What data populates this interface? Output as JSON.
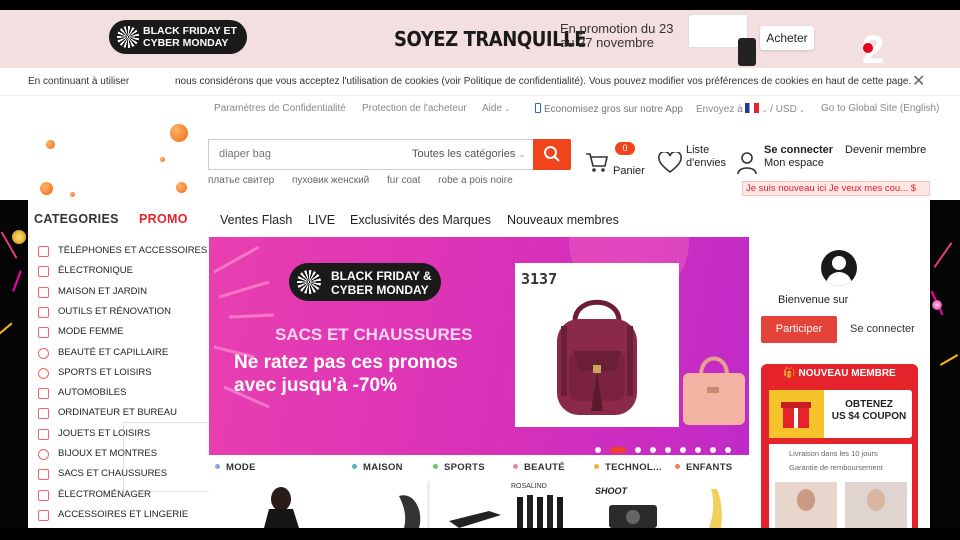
{
  "banner": {
    "bf_line1": "BLACK FRIDAY ET",
    "bf_line2": "CYBER MONDAY",
    "headline": "SOYEZ TRANQUILLE",
    "dates_line1": "En promotion du 23",
    "dates_line2": "au 27 novembre",
    "cta": "Acheter",
    "channel_logo": "2"
  },
  "cookie": {
    "text_start": "En continuant à utiliser",
    "text_rest": "nous considérons que vous acceptez l'utilisation de cookies (voir Politique de confidentialité). Vous pouvez modifier vos préférences de cookies en haut de cette page."
  },
  "utility": {
    "privacy": "Paramètres de Confidentialité",
    "buyer_protection": "Protection de l'acheteur",
    "help": "Aide",
    "app": "Economisez gros sur notre App",
    "ship_to": "Envoyez à",
    "currency": "USD",
    "global": "Go to Global Site (English)"
  },
  "search": {
    "placeholder": "diaper bag",
    "category": "Toutes les catégories",
    "suggestions": [
      "платье свитер",
      "пуховик женский",
      "fur coat",
      "robe a pois noire"
    ]
  },
  "header": {
    "cart_count": "0",
    "cart_label": "Panier",
    "wish_line1": "Liste",
    "wish_line2": "d'envies",
    "login": "Se connecter",
    "my_space": "Mon espace",
    "become_member": "Devenir membre",
    "newbie": "Je suis nouveau ici Je veux mes cou... $"
  },
  "nav": {
    "categories_tab": "CATEGORIES",
    "promo_tab": "PROMO",
    "links": [
      "Ventes Flash",
      "LIVE",
      "Exclusivités des Marques",
      "Nouveaux membres"
    ]
  },
  "sidebar": {
    "items": [
      "Téléphones et Accessoires",
      "Électronique",
      "Maison et Jardin",
      "Outils et Rénovation",
      "Mode Femme",
      "Beauté et Capillaire",
      "Sports et Loisirs",
      "Automobiles",
      "Ordinateur et Bureau",
      "Jouets et Loisirs",
      "Bijoux et Montres",
      "Sacs et Chaussures",
      "Électroménager",
      "Accessoires et Lingerie"
    ]
  },
  "hero": {
    "bf_line1": "BLACK FRIDAY &",
    "bf_line2": "CYBER MONDAY",
    "subtitle": "SACS ET CHAUSSURES",
    "title_line1": "Ne ratez pas ces promos",
    "title_line2": "avec jusqu'à -70%",
    "product_code": "3137",
    "slides": 10,
    "active_slide": 1
  },
  "category_row": [
    {
      "label": "MODE",
      "color": "#8aa6d6"
    },
    {
      "label": "MAISON",
      "color": "#5ab0c8"
    },
    {
      "label": "SPORTS",
      "color": "#6cc36c"
    },
    {
      "label": "BEAUTÉ",
      "color": "#f08a9a"
    },
    {
      "label": "TECHNOL...",
      "color": "#e9b63a"
    },
    {
      "label": "ENFANTS",
      "color": "#f08050"
    }
  ],
  "product_labels": {
    "brand1": "ROSALIND",
    "brand2": "SHOOT"
  },
  "right_panel": {
    "welcome": "Bienvenue sur",
    "participate": "Participer",
    "login": "Se connecter",
    "new_member_title": "NOUVEAU MEMBRE",
    "coupon_line1": "OBTENEZ",
    "coupon_line2": "US $4 COUPON",
    "delivery": "Livraison dans les 10 jours",
    "refund": "Garantie de remboursement"
  },
  "colors": {
    "accent": "#f0441d",
    "promo": "#e4232b",
    "hero": "#d831b9"
  }
}
